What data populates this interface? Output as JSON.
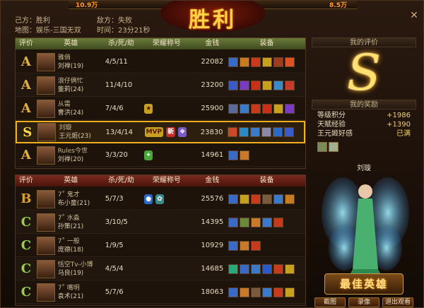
{
  "top": {
    "left_num": "10.9万",
    "right_num": "8.5万",
    "title": "胜利"
  },
  "info": {
    "our_side": "己方：胜利",
    "map": "地图：娱乐-三国无双",
    "enemy_side": "敌方：失败",
    "time": "时间：23分21秒"
  },
  "headers": {
    "grade": "评价",
    "hero": "英雄",
    "kda": "杀/死/助",
    "honor": "荣耀称号",
    "gold": "金钱",
    "equip": "装备"
  },
  "team_a": [
    {
      "grade": "A",
      "title": "雅俏",
      "name": "刘禅(19)",
      "kda": "4/5/11",
      "honors": [],
      "gold": "22082",
      "equip": [
        "#3a6ac8",
        "#c87a20",
        "#c83a1a",
        "#c8a020",
        "#a03a20",
        "#e05020"
      ]
    },
    {
      "grade": "A",
      "title": "浪仔俩忙",
      "name": "董莉(24)",
      "kda": "11/4/10",
      "honors": [],
      "gold": "23200",
      "equip": [
        "#3a5ac8",
        "#7a3ac8",
        "#c8301a",
        "#c8a020",
        "#3a8ac8",
        "#c83a2a"
      ]
    },
    {
      "grade": "A",
      "title": "从需",
      "name": "曹洪(24)",
      "kda": "7/4/6",
      "honors": [
        "hon-gold"
      ],
      "gold": "25900",
      "equip": [
        "#5a6a9a",
        "#3a7ac8",
        "#c83a1a",
        "#c8301a",
        "#c8a020",
        "#7a3ac8"
      ]
    },
    {
      "grade": "S",
      "title": "刘璇",
      "name": "王元姬(23)",
      "kda": "13/4/14",
      "honors": [
        "MVP",
        "新",
        "hon-purple"
      ],
      "gold": "23830",
      "equip": [
        "#c84a2a",
        "#2a8ac8",
        "#3a7ac8",
        "#8a8aa8",
        "#2a6ac8",
        "#3a5ac8"
      ],
      "highlight": true
    },
    {
      "grade": "A",
      "title": "Rules今世",
      "name": "刘禅(20)",
      "kda": "3/3/20",
      "honors": [
        "hon-green"
      ],
      "gold": "14961",
      "equip": [
        "#3a6ac8",
        "#c87a2a"
      ]
    }
  ],
  "team_b": [
    {
      "grade": "B",
      "title": "7˚  鬼才",
      "name": "布小童(21)",
      "kda": "5/7/3",
      "honors": [
        "hon-blue",
        "hon-teal"
      ],
      "gold": "25576",
      "equip": [
        "#3a6ac8",
        "#c8a020",
        "#c83a1a",
        "#7a5a3a",
        "#3a7ac8",
        "#c87a20"
      ]
    },
    {
      "grade": "C",
      "title": "7˚  水淼",
      "name": "孙策(21)",
      "kda": "3/10/5",
      "honors": [],
      "gold": "14395",
      "equip": [
        "#3a6ac8",
        "#6a8a3a",
        "#c87a2a",
        "#3a7ac8",
        "#c83a1a"
      ]
    },
    {
      "grade": "C",
      "title": "7˚  一般",
      "name": "庞德(18)",
      "kda": "1/9/5",
      "honors": [],
      "gold": "10929",
      "equip": [
        "#3a6ac8",
        "#c87a2a",
        "#c83a1a"
      ]
    },
    {
      "grade": "C",
      "title": "恬空Tv-小博",
      "name": "马良(19)",
      "kda": "4/5/4",
      "honors": [],
      "gold": "14685",
      "equip": [
        "#2aa87a",
        "#3a6ac8",
        "#3a7ac8",
        "#2a5ac8",
        "#c83a1a",
        "#c8a020"
      ]
    },
    {
      "grade": "C",
      "title": "7˚  嘴明",
      "name": "袁术(21)",
      "kda": "5/7/6",
      "honors": [],
      "gold": "18063",
      "equip": [
        "#3a6ac8",
        "#c87a2a",
        "#7a5a3a",
        "#3a7ac8",
        "#c83a1a",
        "#c8a020"
      ]
    }
  ],
  "side": {
    "my_rating_label": "我的评价",
    "my_rating": "S",
    "my_reward_label": "我的奖励",
    "rewards": [
      {
        "label": "等级积分",
        "value": "+1986"
      },
      {
        "label": "天赋经验",
        "value": "+1390"
      },
      {
        "label": "王元姬好感",
        "value": "已满"
      }
    ],
    "best_hero_name": "刘璇",
    "best_hero_badge": "最佳英雄",
    "buttons": [
      "截图",
      "录像",
      "退出观看"
    ]
  },
  "colors": {
    "grade_A": "#e0b040",
    "grade_S": "#ffd84a",
    "grade_B": "#d8a030",
    "grade_C": "#9ad04a"
  }
}
